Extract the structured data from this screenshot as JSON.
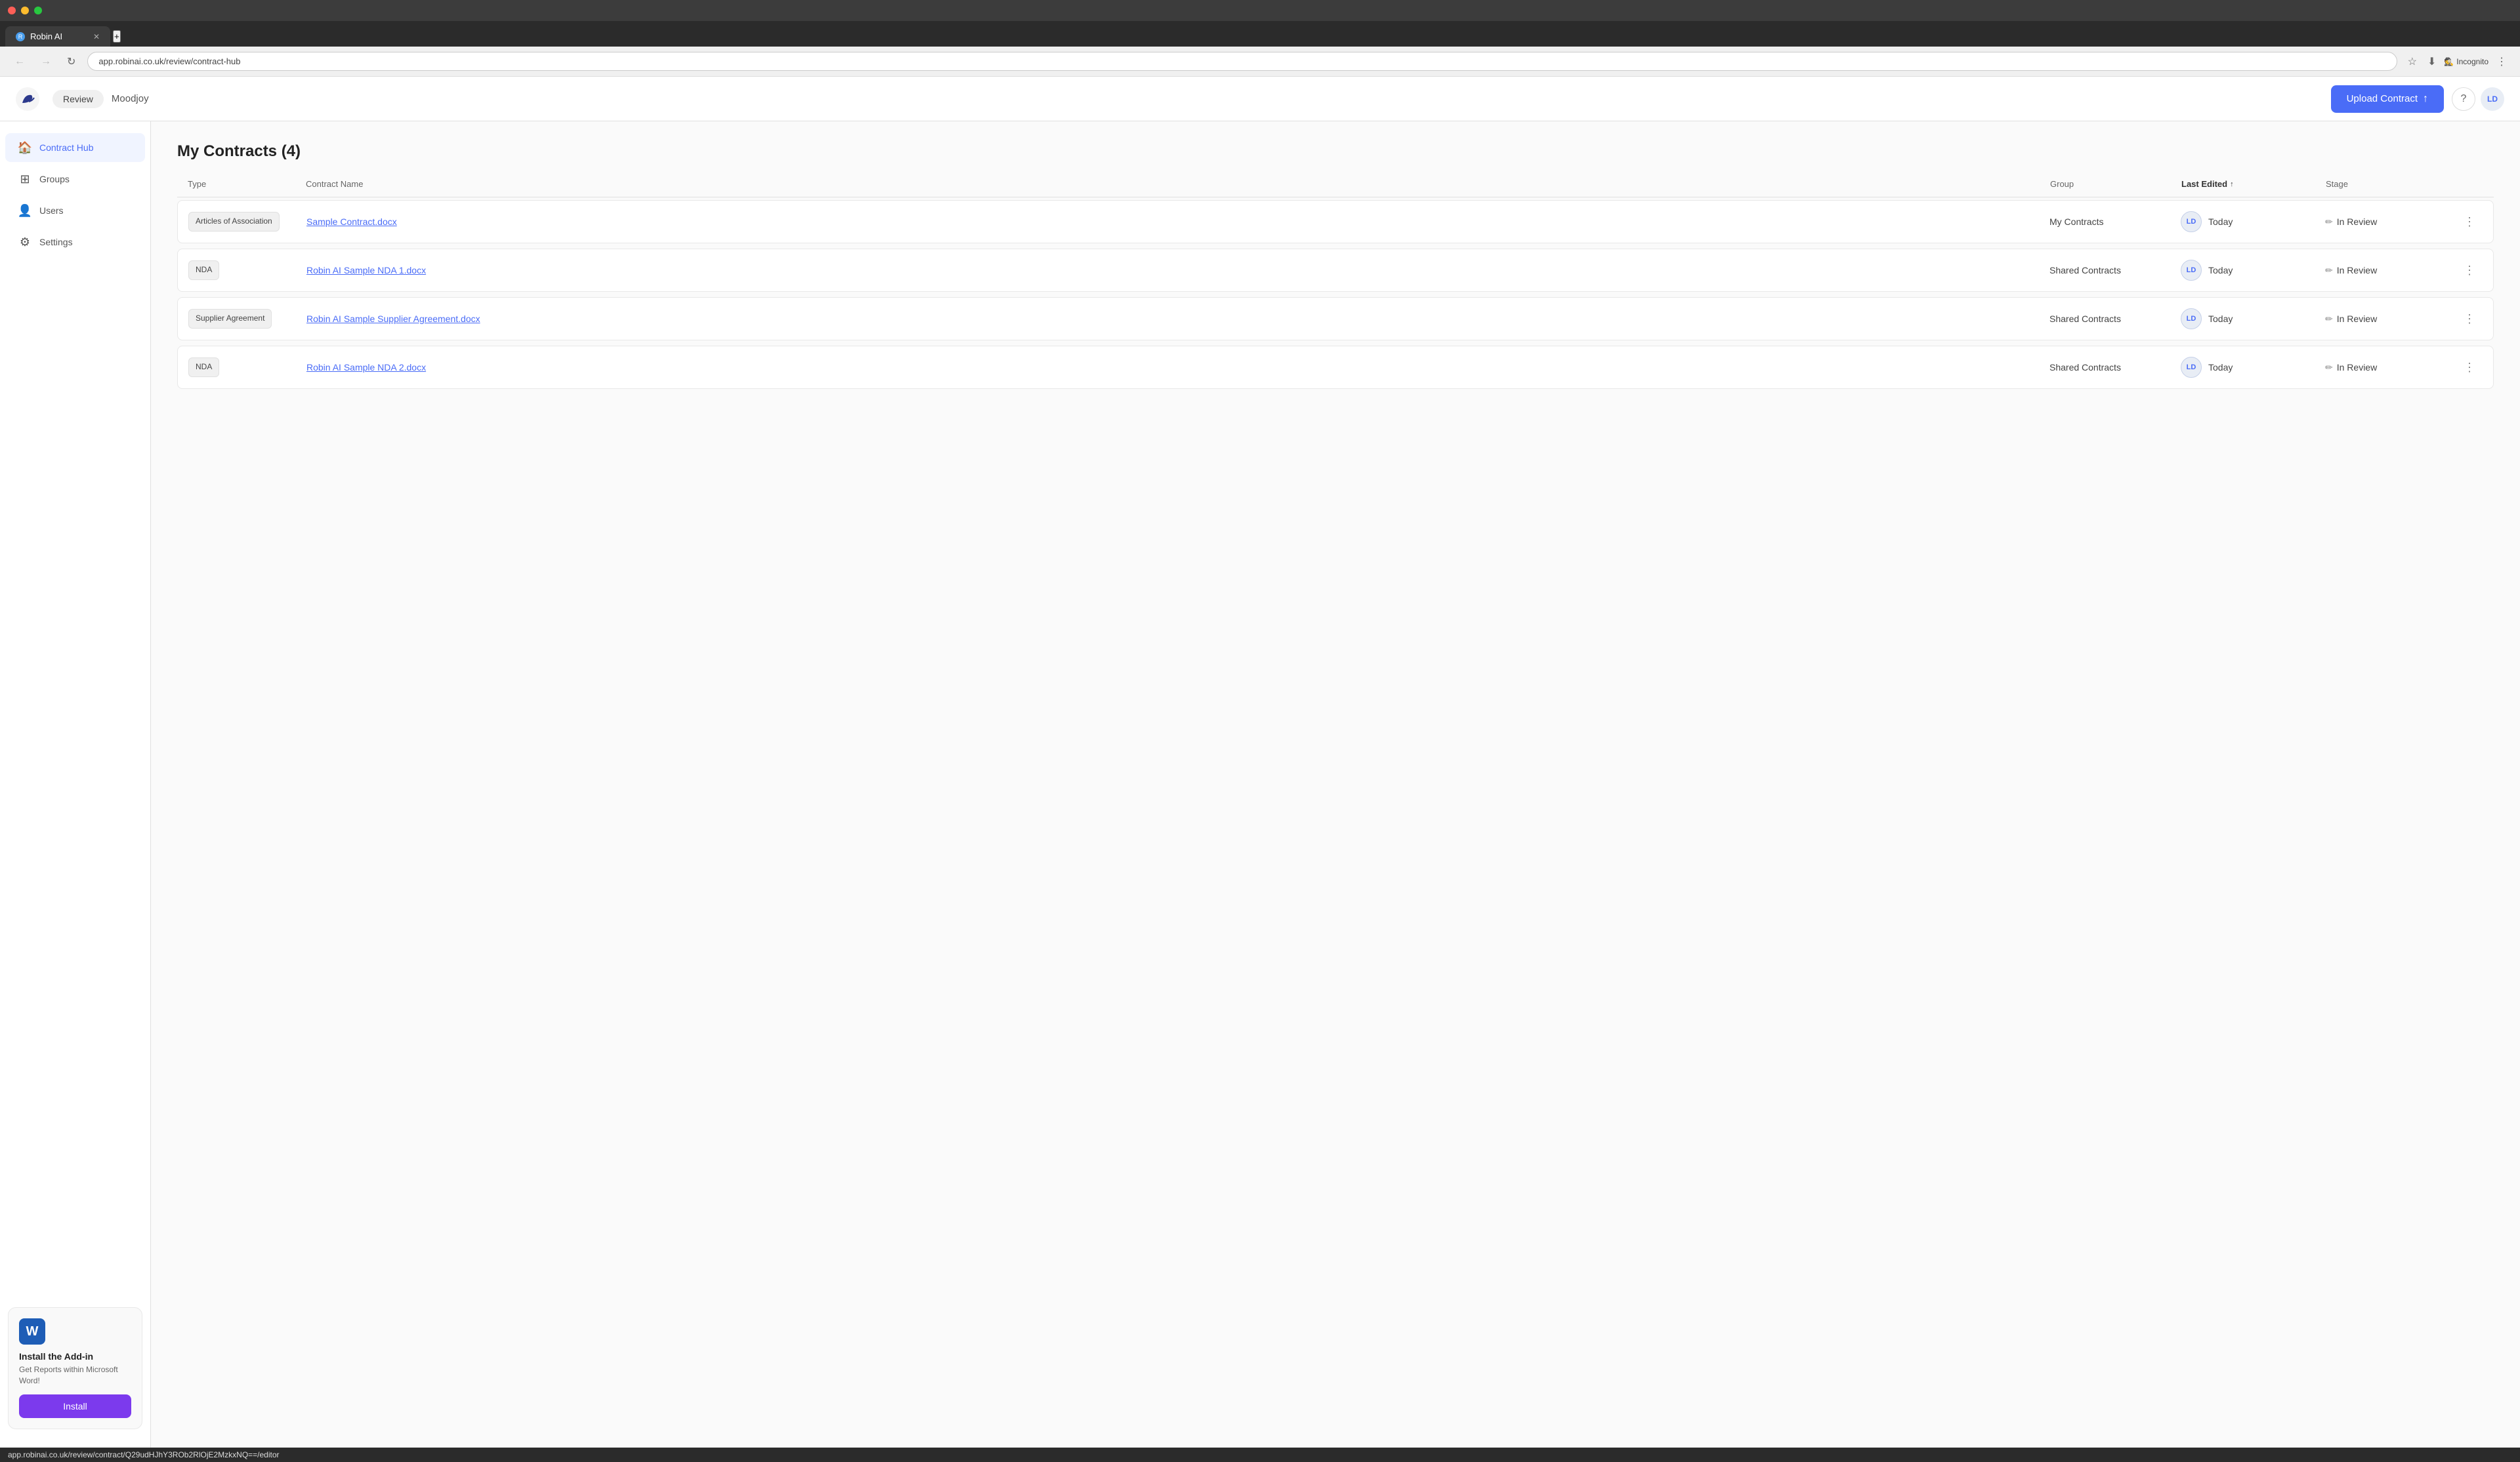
{
  "browser": {
    "tab_label": "Robin AI",
    "tab_new_label": "+",
    "url": "app.robinai.co.uk/review/contract-hub",
    "nav_back": "←",
    "nav_forward": "→",
    "nav_refresh": "↻",
    "incognito_label": "Incognito",
    "toolbar_icons": [
      "☆",
      "⬇",
      "⋮"
    ]
  },
  "header": {
    "review_label": "Review",
    "company_name": "Moodjoy",
    "upload_btn_label": "Upload Contract",
    "help_icon": "?",
    "avatar_label": "LD"
  },
  "sidebar": {
    "items": [
      {
        "id": "contract-hub",
        "label": "Contract Hub",
        "icon": "🏠",
        "active": true
      },
      {
        "id": "groups",
        "label": "Groups",
        "icon": "⊞",
        "active": false
      },
      {
        "id": "users",
        "label": "Users",
        "icon": "👤",
        "active": false
      },
      {
        "id": "settings",
        "label": "Settings",
        "icon": "⚙",
        "active": false
      }
    ],
    "addon": {
      "word_icon_label": "W",
      "title": "Install the Add-in",
      "description": "Get Reports within Microsoft Word!",
      "install_btn_label": "Install"
    }
  },
  "main": {
    "page_title": "My Contracts (4)",
    "table": {
      "columns": [
        {
          "id": "type",
          "label": "Type"
        },
        {
          "id": "contract_name",
          "label": "Contract Name"
        },
        {
          "id": "group",
          "label": "Group"
        },
        {
          "id": "last_edited",
          "label": "Last Edited",
          "sorted": true,
          "sort_dir": "↑"
        },
        {
          "id": "stage",
          "label": "Stage"
        }
      ],
      "rows": [
        {
          "type": "Articles of Association",
          "contract_name": "Sample Contract.docx",
          "group": "My Contracts",
          "avatar": "LD",
          "date": "Today",
          "stage": "In Review",
          "stage_icon": "✏"
        },
        {
          "type": "NDA",
          "contract_name": "Robin AI Sample NDA 1.docx",
          "group": "Shared Contracts",
          "avatar": "LD",
          "date": "Today",
          "stage": "In Review",
          "stage_icon": "✏"
        },
        {
          "type": "Supplier Agreement",
          "contract_name": "Robin AI Sample Supplier Agreement.docx",
          "group": "Shared Contracts",
          "avatar": "LD",
          "date": "Today",
          "stage": "In Review",
          "stage_icon": "✏"
        },
        {
          "type": "NDA",
          "contract_name": "Robin AI Sample NDA 2.docx",
          "group": "Shared Contracts",
          "avatar": "LD",
          "date": "Today",
          "stage": "In Review",
          "stage_icon": "✏"
        }
      ]
    }
  },
  "status_bar": {
    "url": "app.robinai.co.uk/review/contract/Q29udHJhY3ROb2RlOjE2MzkxNQ==/editor"
  }
}
